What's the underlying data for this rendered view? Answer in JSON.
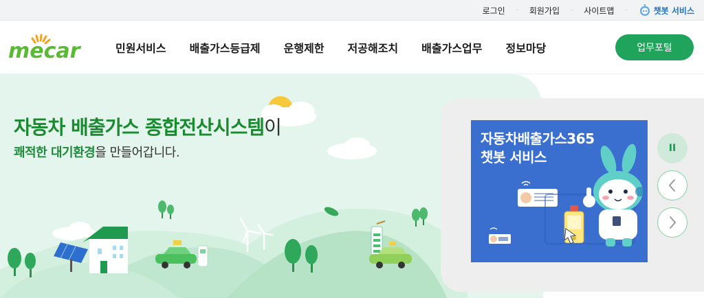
{
  "utility": {
    "links": [
      "로그인",
      "회원가입",
      "사이트맵"
    ],
    "chatbot_label": "챗봇 서비스"
  },
  "logo": {
    "text": "mecar"
  },
  "nav": {
    "items": [
      "민원서비스",
      "배출가스등급제",
      "운행제한",
      "저공해조치",
      "배출가스업무",
      "정보마당"
    ],
    "portal_button": "업무포털"
  },
  "hero": {
    "title_main": "자동차 배출가스 종합전산시스템",
    "title_suffix": "이",
    "subtitle_highlight": "쾌적한 대기환경",
    "subtitle_rest": "을 만들어갑니다."
  },
  "banner": {
    "line1": "자동차배출가스365",
    "line2": "챗봇 서비스"
  },
  "controls": {
    "pause_symbol": "II"
  },
  "colors": {
    "brand_green": "#20a35a",
    "title_green": "#198a2e",
    "banner_blue": "#3a6fd0",
    "chatbot_blue": "#1a73c9"
  },
  "icons": [
    "chatbot-robot-icon",
    "pause-icon",
    "chevron-left-icon",
    "chevron-right-icon"
  ]
}
